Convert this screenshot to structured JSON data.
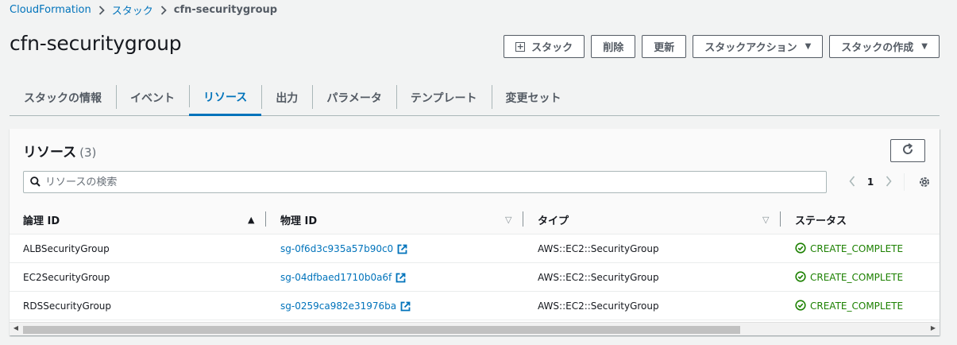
{
  "breadcrumb": {
    "items": [
      "CloudFormation",
      "スタック"
    ],
    "current": "cfn-securitygroup"
  },
  "page_title": "cfn-securitygroup",
  "actions": {
    "stack_label": "スタック",
    "delete_label": "削除",
    "update_label": "更新",
    "stack_actions_label": "スタックアクション",
    "create_stack_label": "スタックの作成"
  },
  "tabs": [
    {
      "label": "スタックの情報",
      "active": false
    },
    {
      "label": "イベント",
      "active": false
    },
    {
      "label": "リソース",
      "active": true
    },
    {
      "label": "出力",
      "active": false
    },
    {
      "label": "パラメータ",
      "active": false
    },
    {
      "label": "テンプレート",
      "active": false
    },
    {
      "label": "変更セット",
      "active": false
    }
  ],
  "resources": {
    "title": "リソース",
    "count": "(3)",
    "search_placeholder": "リソースの検索",
    "page_number": "1",
    "columns": [
      "論理 ID",
      "物理 ID",
      "タイプ",
      "ステータス"
    ],
    "rows": [
      {
        "logical_id": "ALBSecurityGroup",
        "physical_id": "sg-0f6d3c935a57b90c0",
        "type": "AWS::EC2::SecurityGroup",
        "status": "CREATE_COMPLETE"
      },
      {
        "logical_id": "EC2SecurityGroup",
        "physical_id": "sg-04dfbaed1710b0a6f",
        "type": "AWS::EC2::SecurityGroup",
        "status": "CREATE_COMPLETE"
      },
      {
        "logical_id": "RDSSecurityGroup",
        "physical_id": "sg-0259ca982e31976ba",
        "type": "AWS::EC2::SecurityGroup",
        "status": "CREATE_COMPLETE"
      }
    ]
  },
  "colors": {
    "link": "#0073bb",
    "success": "#1d8102",
    "text": "#16191f",
    "background": "#f2f3f3"
  },
  "icons": [
    "chevron-right-icon",
    "plus-box-icon",
    "caret-down-icon",
    "refresh-icon",
    "search-icon",
    "chevron-left-icon",
    "settings-gear-icon",
    "sort-ascending-icon",
    "sort-descending-icon",
    "external-link-icon",
    "success-check-icon"
  ]
}
